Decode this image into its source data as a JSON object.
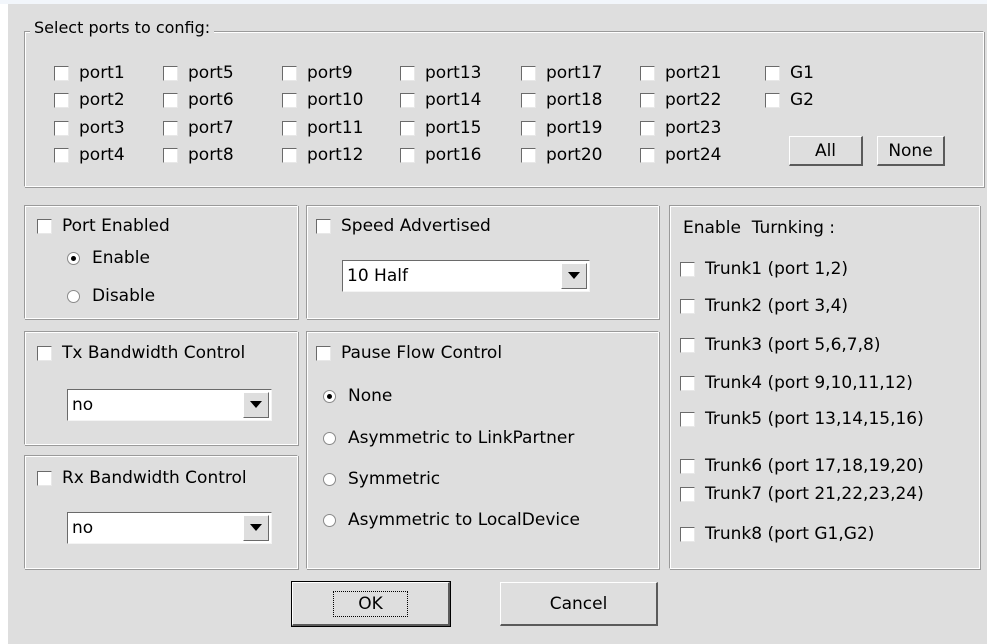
{
  "ports_group": {
    "legend": "Select ports to config:",
    "ports": [
      "port1",
      "port2",
      "port3",
      "port4",
      "port5",
      "port6",
      "port7",
      "port8",
      "port9",
      "port10",
      "port11",
      "port12",
      "port13",
      "port14",
      "port15",
      "port16",
      "port17",
      "port18",
      "port19",
      "port20",
      "port21",
      "port22",
      "port23",
      "port24"
    ],
    "gig_ports": [
      "G1",
      "G2"
    ],
    "all_label": "All",
    "none_label": "None"
  },
  "port_enabled": {
    "label": "Port Enabled",
    "options": [
      "Enable",
      "Disable"
    ],
    "selected": "Enable"
  },
  "speed": {
    "label": "Speed Advertised",
    "value": "10 Half"
  },
  "tx_bandwidth": {
    "label": "Tx Bandwidth Control",
    "value": "no"
  },
  "rx_bandwidth": {
    "label": "Rx Bandwidth Control",
    "value": "no"
  },
  "pause_flow": {
    "label": "Pause Flow Control",
    "options": [
      "None",
      "Asymmetric to LinkPartner",
      "Symmetric",
      "Asymmetric to LocalDevice"
    ],
    "selected": "None"
  },
  "trunking": {
    "title": "Enable  Turnking :",
    "items": [
      "Trunk1 (port 1,2)",
      "Trunk2 (port 3,4)",
      "Trunk3 (port 5,6,7,8)",
      "Trunk4 (port 9,10,11,12)",
      "Trunk5 (port 13,14,15,16)",
      "Trunk6 (port 17,18,19,20)",
      "Trunk7 (port 21,22,23,24)",
      "Trunk8 (port G1,G2)"
    ]
  },
  "buttons": {
    "ok": "OK",
    "cancel": "Cancel"
  }
}
